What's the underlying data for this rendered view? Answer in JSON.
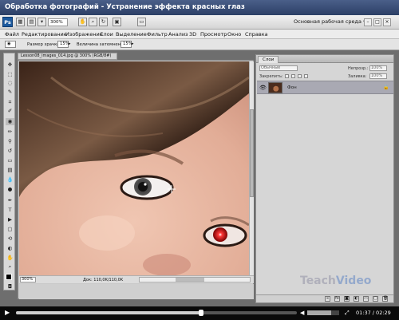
{
  "window": {
    "title": "Обработка фотографий - Устранение эффекта красных глаз"
  },
  "appbar": {
    "logo": "Ps",
    "zoom": "300%",
    "workspace": "Основная рабочая среда",
    "workspace_arrow": "▾"
  },
  "menu": [
    "Файл",
    "Редактирование",
    "Изображение",
    "Слои",
    "Выделение",
    "Фильтр",
    "Анализ",
    "3D",
    "Просмотр",
    "Окно",
    "Справка"
  ],
  "options": {
    "pupil_label": "Размер зрачка:",
    "pupil_value": "15%",
    "darken_label": "Величина затемнения:",
    "darken_value": "15%"
  },
  "document": {
    "tab_title": "Lesson08_images_014.jpg @ 300% (RGB/8#)",
    "status_zoom": "300%",
    "status_doc": "Док: 110,0K/110,0K"
  },
  "layers_panel": {
    "tab": "Слои",
    "blend_mode": "Обычные",
    "opacity_label": "Непрозр.:",
    "opacity_value": "100%",
    "lock_label": "Закрепить:",
    "fill_label": "Заливка:",
    "fill_value": "100%",
    "layer_name": "Фон"
  },
  "watermark": {
    "part1": "Teach",
    "part2": "Video"
  },
  "player": {
    "time": "01:37 / 02:29",
    "progress": 0.66
  },
  "icons": {
    "move": "move-icon",
    "hand": "hand-icon",
    "zoom": "zoom-icon",
    "eye": "eye-icon",
    "lock": "lock-icon"
  }
}
